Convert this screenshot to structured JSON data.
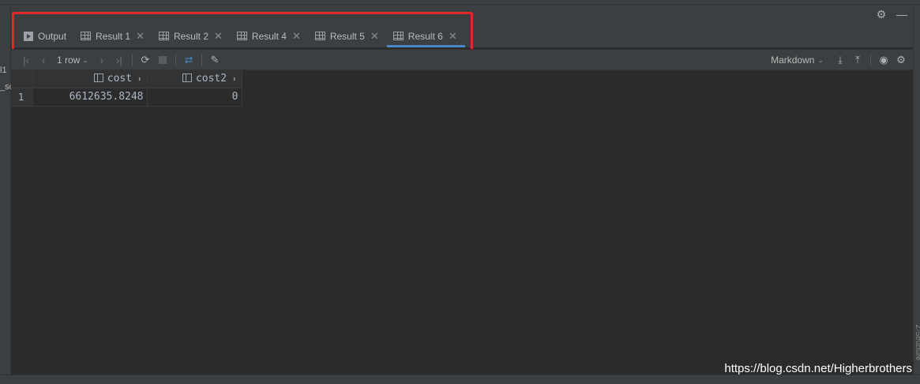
{
  "header": {
    "icons": [
      "gear-icon",
      "minimize-icon"
    ]
  },
  "gutter": {
    "fragment_top": "l1",
    "fragment_mid": "_sc"
  },
  "tabs": [
    {
      "label": "Output",
      "icon": "output-icon",
      "closable": false,
      "active": false
    },
    {
      "label": "Result 1",
      "icon": "table-icon",
      "closable": true,
      "active": false
    },
    {
      "label": "Result 2",
      "icon": "table-icon",
      "closable": true,
      "active": false
    },
    {
      "label": "Result 4",
      "icon": "table-icon",
      "closable": true,
      "active": false
    },
    {
      "label": "Result 5",
      "icon": "table-icon",
      "closable": true,
      "active": false
    },
    {
      "label": "Result 6",
      "icon": "table-icon",
      "closable": true,
      "active": true
    }
  ],
  "highlight_color": "#e02a2a",
  "toolbar": {
    "rows_label": "1 row",
    "format_label": "Markdown"
  },
  "table": {
    "columns": [
      "cost",
      "cost2"
    ],
    "rows": [
      {
        "num": "1",
        "cells": [
          "6612635.8248",
          "0"
        ]
      }
    ]
  },
  "watermark": "https://blog.csdn.net/Higherbrothers",
  "side_label": "Z-Structure",
  "colors": {
    "accent": "#4a88c7",
    "background": "#2b2b2b",
    "chrome": "#3c3f41"
  }
}
